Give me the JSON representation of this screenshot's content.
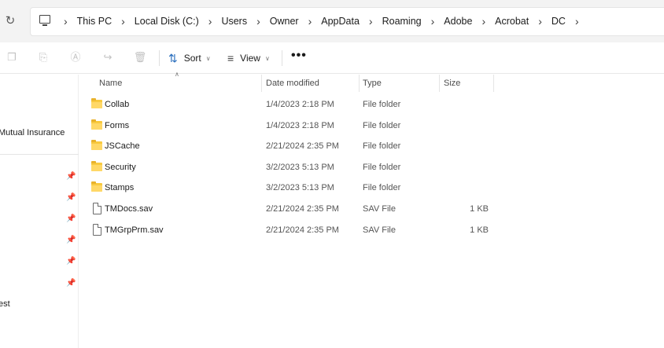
{
  "address_bar": {
    "breadcrumbs": [
      "This PC",
      "Local Disk (C:)",
      "Users",
      "Owner",
      "AppData",
      "Roaming",
      "Adobe",
      "Acrobat",
      "DC"
    ]
  },
  "toolbar": {
    "sort_label": "Sort",
    "view_label": "View",
    "more_label": "•••"
  },
  "nav_pane": {
    "items": [
      "Mutual Insurance",
      "est"
    ]
  },
  "columns": {
    "name": "Name",
    "date": "Date modified",
    "type": "Type",
    "size": "Size"
  },
  "files": [
    {
      "name": "Collab",
      "date": "1/4/2023 2:18 PM",
      "type": "File folder",
      "size": "",
      "icon": "folder-icon"
    },
    {
      "name": "Forms",
      "date": "1/4/2023 2:18 PM",
      "type": "File folder",
      "size": "",
      "icon": "folder-icon"
    },
    {
      "name": "JSCache",
      "date": "2/21/2024 2:35 PM",
      "type": "File folder",
      "size": "",
      "icon": "folder-icon"
    },
    {
      "name": "Security",
      "date": "3/2/2023 5:13 PM",
      "type": "File folder",
      "size": "",
      "icon": "folder-icon"
    },
    {
      "name": "Stamps",
      "date": "3/2/2023 5:13 PM",
      "type": "File folder",
      "size": "",
      "icon": "folder-icon"
    },
    {
      "name": "TMDocs.sav",
      "date": "2/21/2024 2:35 PM",
      "type": "SAV File",
      "size": "1 KB",
      "icon": "file-icon"
    },
    {
      "name": "TMGrpPrm.sav",
      "date": "2/21/2024 2:35 PM",
      "type": "SAV File",
      "size": "1 KB",
      "icon": "file-icon"
    }
  ],
  "colors": {
    "accent": "#2a6ebd",
    "folder": "#f8c93f"
  }
}
